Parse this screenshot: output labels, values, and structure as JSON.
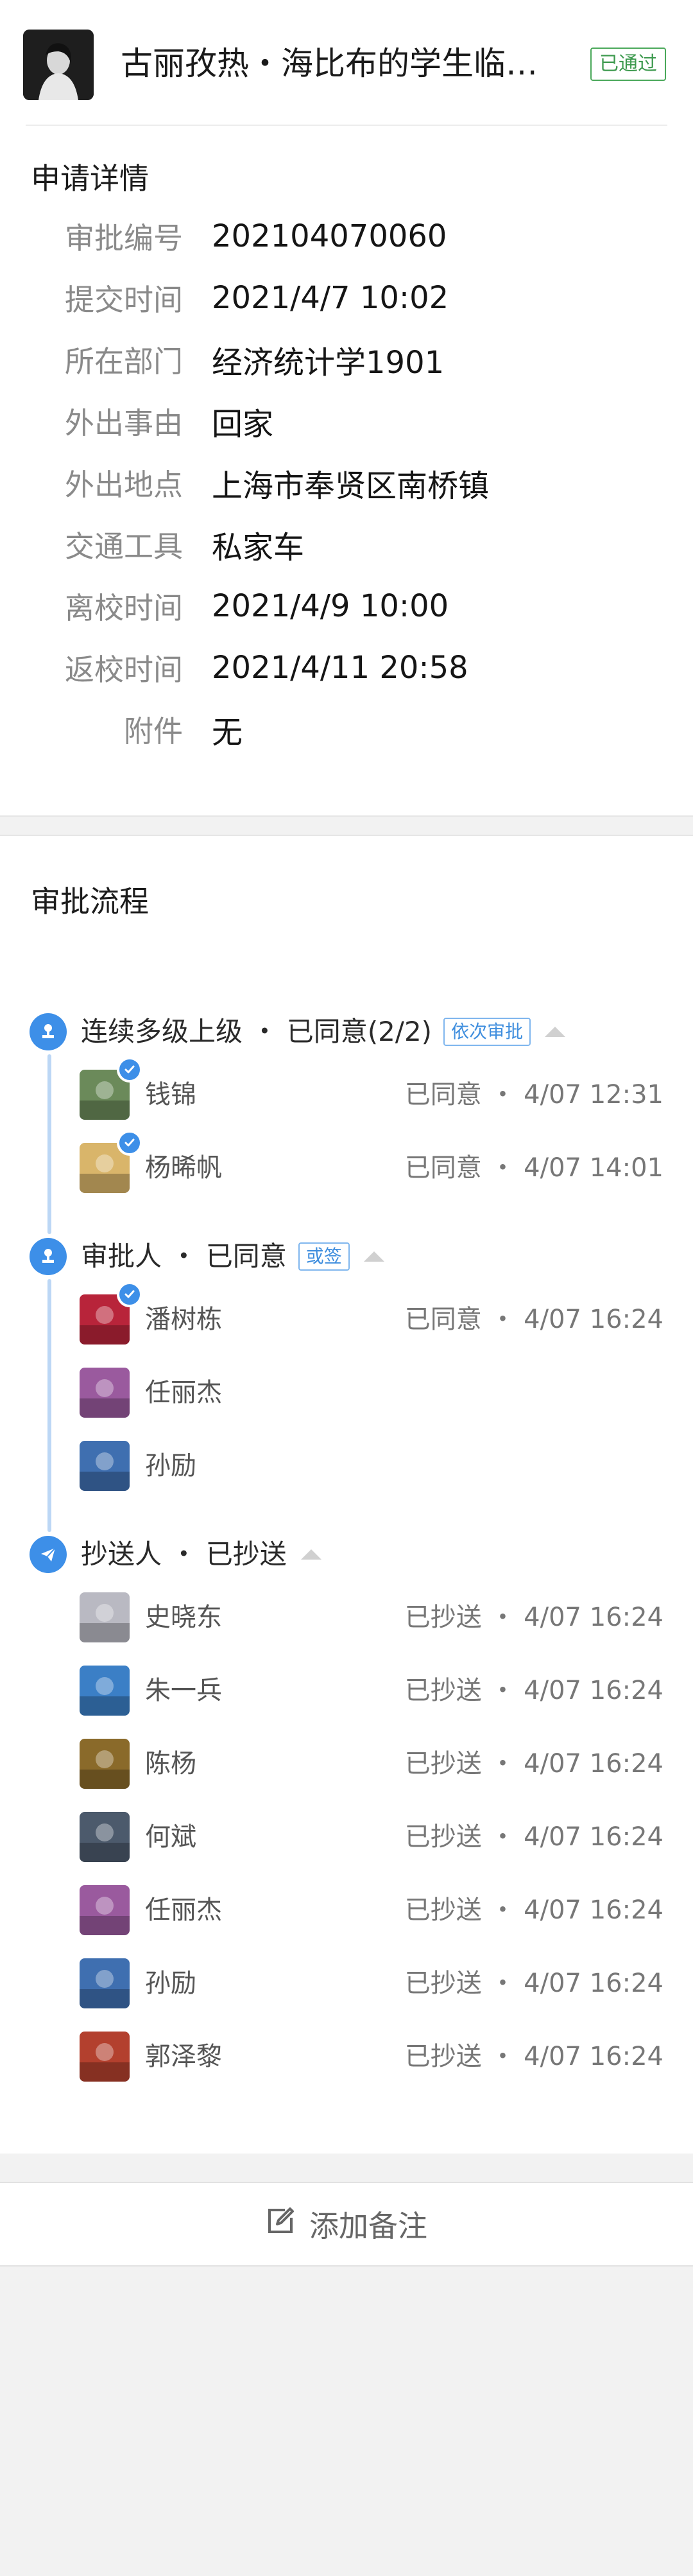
{
  "header": {
    "title": "古丽孜热・海比布的学生临…",
    "status": "已通过"
  },
  "details": {
    "title": "申请详情",
    "rows": [
      {
        "label": "审批编号",
        "value": "202104070060"
      },
      {
        "label": "提交时间",
        "value": "2021/4/7 10:02"
      },
      {
        "label": "所在部门",
        "value": "经济统计学1901"
      },
      {
        "label": "外出事由",
        "value": "回家"
      },
      {
        "label": "外出地点",
        "value": "上海市奉贤区南桥镇"
      },
      {
        "label": "交通工具",
        "value": "私家车"
      },
      {
        "label": "离校时间",
        "value": "2021/4/9 10:00"
      },
      {
        "label": "返校时间",
        "value": "2021/4/11 20:58"
      },
      {
        "label": "附件",
        "value": "无"
      }
    ]
  },
  "flow": {
    "title": "审批流程",
    "nodes": [
      {
        "label": "连续多级上级 ・ 已同意(2/2)",
        "tag": "依次审批",
        "icon": "user-icon",
        "people": [
          {
            "name": "钱锦",
            "status": "已同意 ・ 4/07 12:31",
            "checked": true,
            "avatar_color": "#6b8a5a"
          },
          {
            "name": "杨晞帆",
            "status": "已同意 ・ 4/07 14:01",
            "checked": true,
            "avatar_color": "#d9b56a"
          }
        ]
      },
      {
        "label": "审批人 ・ 已同意",
        "tag": "或签",
        "icon": "user-icon",
        "people": [
          {
            "name": "潘树栋",
            "status": "已同意 ・ 4/07 16:24",
            "checked": true,
            "avatar_color": "#b8243a"
          },
          {
            "name": "任丽杰",
            "status": "",
            "checked": false,
            "avatar_color": "#9a5a9e"
          },
          {
            "name": "孙励",
            "status": "",
            "checked": false,
            "avatar_color": "#3f6fb0"
          }
        ]
      },
      {
        "label": "抄送人 ・ 已抄送",
        "tag": "",
        "icon": "send-icon",
        "people": [
          {
            "name": "史晓东",
            "status": "已抄送 ・ 4/07 16:24",
            "checked": false,
            "avatar_color": "#b9b9c2"
          },
          {
            "name": "朱一兵",
            "status": "已抄送 ・ 4/07 16:24",
            "checked": false,
            "avatar_color": "#3b7fc6"
          },
          {
            "name": "陈杨",
            "status": "已抄送 ・ 4/07 16:24",
            "checked": false,
            "avatar_color": "#8a6a2a"
          },
          {
            "name": "何斌",
            "status": "已抄送 ・ 4/07 16:24",
            "checked": false,
            "avatar_color": "#4c5a6c"
          },
          {
            "name": "任丽杰",
            "status": "已抄送 ・ 4/07 16:24",
            "checked": false,
            "avatar_color": "#9a5a9e"
          },
          {
            "name": "孙励",
            "status": "已抄送 ・ 4/07 16:24",
            "checked": false,
            "avatar_color": "#3f6fb0"
          },
          {
            "name": "郭泽黎",
            "status": "已抄送 ・ 4/07 16:24",
            "checked": false,
            "avatar_color": "#b3402e"
          }
        ]
      }
    ]
  },
  "bottom": {
    "add_note_label": "添加备注",
    "icon": "edit-icon"
  },
  "colors": {
    "accent": "#3d8fe8",
    "approved": "#3e9a4f"
  }
}
